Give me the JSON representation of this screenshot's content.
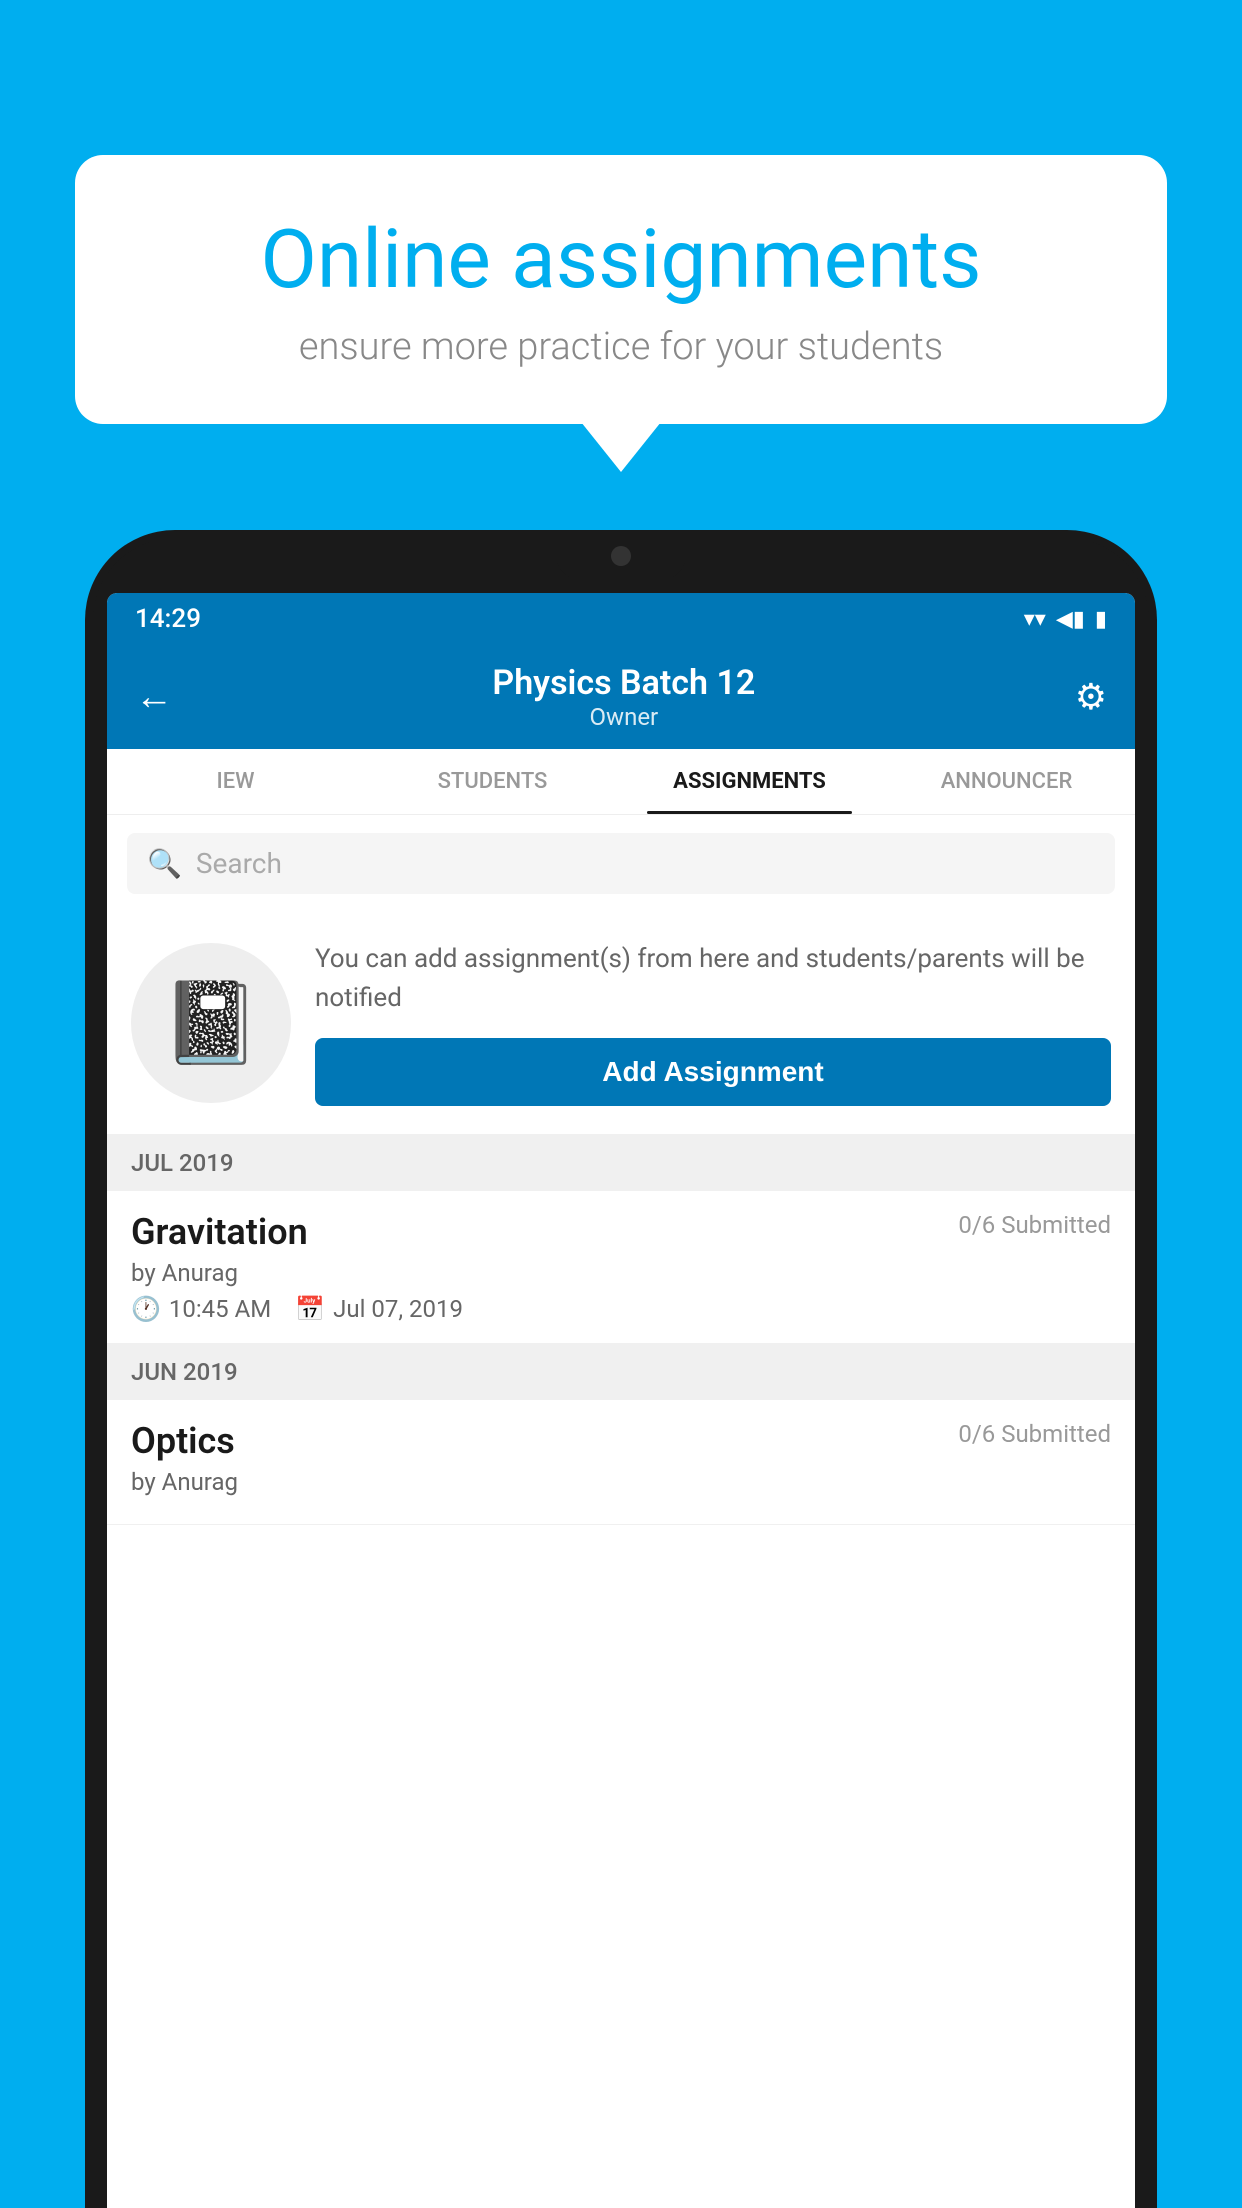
{
  "background": {
    "color": "#00AEEF"
  },
  "speech_bubble": {
    "title": "Online assignments",
    "subtitle": "ensure more practice for your students"
  },
  "status_bar": {
    "time": "14:29",
    "wifi": "▼",
    "signal": "◀",
    "battery": "▮"
  },
  "header": {
    "title": "Physics Batch 12",
    "subtitle": "Owner",
    "back_label": "←",
    "settings_label": "⚙"
  },
  "tabs": [
    {
      "label": "IEW",
      "active": false
    },
    {
      "label": "STUDENTS",
      "active": false
    },
    {
      "label": "ASSIGNMENTS",
      "active": true
    },
    {
      "label": "ANNOUNCER",
      "active": false
    }
  ],
  "search": {
    "placeholder": "Search"
  },
  "promo": {
    "text": "You can add assignment(s) from here and students/parents will be notified",
    "button_label": "Add Assignment"
  },
  "sections": [
    {
      "label": "JUL 2019",
      "assignments": [
        {
          "name": "Gravitation",
          "submitted": "0/6 Submitted",
          "by": "by Anurag",
          "time": "10:45 AM",
          "date": "Jul 07, 2019"
        }
      ]
    },
    {
      "label": "JUN 2019",
      "assignments": [
        {
          "name": "Optics",
          "submitted": "0/6 Submitted",
          "by": "by Anurag",
          "time": "",
          "date": ""
        }
      ]
    }
  ]
}
